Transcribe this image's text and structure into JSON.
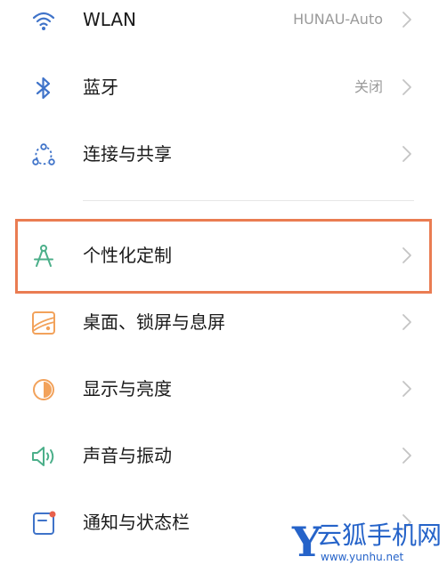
{
  "settings": {
    "items": [
      {
        "icon": "wifi-icon",
        "label": "WLAN",
        "value": "HUNAU-Auto"
      },
      {
        "icon": "bluetooth-icon",
        "label": "蓝牙",
        "value": "关闭"
      },
      {
        "icon": "connection-sharing-icon",
        "label": "连接与共享"
      },
      {
        "icon": "compass-icon",
        "label": "个性化定制"
      },
      {
        "icon": "wallpaper-icon",
        "label": "桌面、锁屏与息屏"
      },
      {
        "icon": "brightness-icon",
        "label": "显示与亮度"
      },
      {
        "icon": "speaker-icon",
        "label": "声音与振动"
      },
      {
        "icon": "notification-icon",
        "label": "通知与状态栏"
      }
    ]
  },
  "colors": {
    "highlight": "#ea7c52",
    "icon_blue": "#3f73c9",
    "icon_green": "#4caf8a",
    "icon_orange": "#f2a25b",
    "watermark": "#2563c9"
  },
  "watermark": {
    "letter": "Y",
    "name": "云狐手机网",
    "url": "www.yunhu.net"
  }
}
